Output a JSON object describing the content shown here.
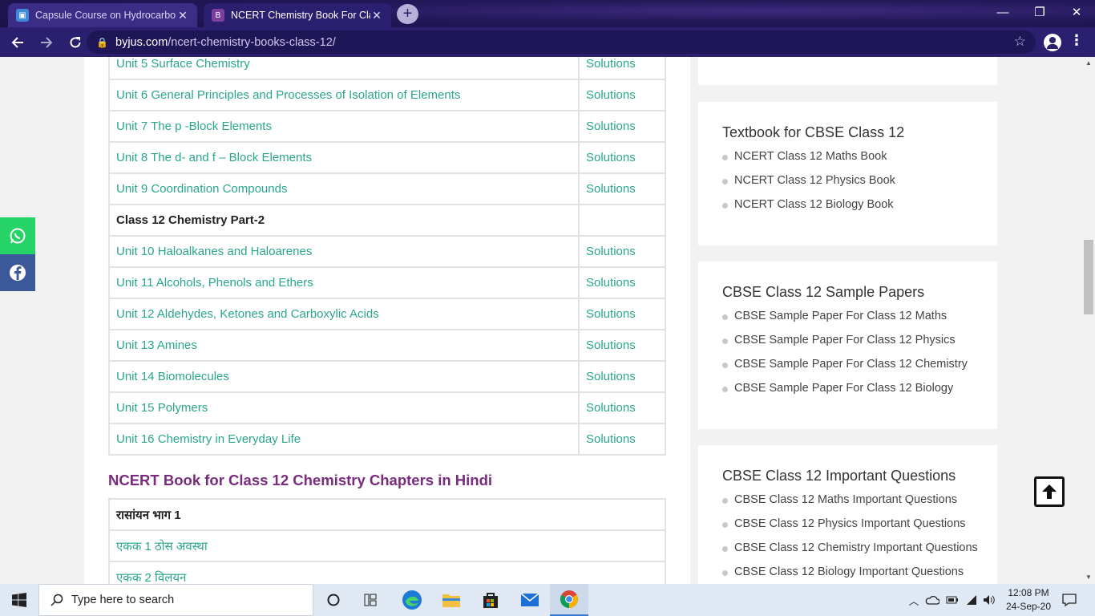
{
  "browser": {
    "tabs": [
      {
        "title": "Capsule Course on Hydrocarbon",
        "active": false
      },
      {
        "title": "NCERT Chemistry Book For Class",
        "active": true
      }
    ],
    "url_host": "byjus.com",
    "url_path": "/ncert-chemistry-books-class-12/"
  },
  "chapters_table": {
    "rows": [
      {
        "chapter": "Unit 5 Surface Chemistry",
        "solutions": "Solutions"
      },
      {
        "chapter": "Unit 6 General Principles and Processes of Isolation of Elements",
        "solutions": "Solutions"
      },
      {
        "chapter": "Unit 7 The p -Block Elements",
        "solutions": "Solutions"
      },
      {
        "chapter": "Unit 8 The d- and f – Block Elements",
        "solutions": "Solutions"
      },
      {
        "chapter": "Unit 9 Coordination Compounds",
        "solutions": "Solutions"
      },
      {
        "chapter": "Class 12 Chemistry Part-2",
        "solutions": ""
      },
      {
        "chapter": "Unit 10 Haloalkanes and Haloarenes",
        "solutions": "Solutions"
      },
      {
        "chapter": "Unit 11 Alcohols, Phenols and Ethers",
        "solutions": "Solutions"
      },
      {
        "chapter": "Unit 12 Aldehydes, Ketones and Carboxylic Acids",
        "solutions": "Solutions"
      },
      {
        "chapter": "Unit 13 Amines",
        "solutions": "Solutions"
      },
      {
        "chapter": "Unit 14 Biomolecules",
        "solutions": "Solutions"
      },
      {
        "chapter": "Unit 15 Polymers",
        "solutions": "Solutions"
      },
      {
        "chapter": "Unit 16 Chemistry in Everyday Life",
        "solutions": "Solutions"
      }
    ]
  },
  "hindi_section": {
    "title": "NCERT Book for Class 12 Chemistry Chapters in Hindi",
    "rows": [
      "रासांयन भाग 1",
      "एकक 1 ठोस अवस्था",
      "एकक 2 विलयन"
    ]
  },
  "sidebar": {
    "textbooks": {
      "title": "Textbook for CBSE Class 12",
      "items": [
        "NCERT Class 12 Maths Book",
        "NCERT Class 12 Physics Book",
        "NCERT Class 12 Biology Book"
      ]
    },
    "sample_papers": {
      "title": "CBSE Class 12 Sample Papers",
      "items": [
        "CBSE Sample Paper For Class 12 Maths",
        "CBSE Sample Paper For Class 12 Physics",
        "CBSE Sample Paper For Class 12 Chemistry",
        "CBSE Sample Paper For Class 12 Biology"
      ]
    },
    "important_questions": {
      "title": "CBSE Class 12 Important Questions",
      "items": [
        "CBSE Class 12 Maths Important Questions",
        "CBSE Class 12 Physics Important Questions",
        "CBSE Class 12 Chemistry Important Questions",
        "CBSE Class 12 Biology Important Questions"
      ]
    }
  },
  "taskbar": {
    "search_placeholder": "Type here to search",
    "time": "12:08 PM",
    "date": "24-Sep-20"
  },
  "colors": {
    "link": "#2aa68c",
    "heading_purple": "#7a2b7e",
    "browser_frame": "#2b2070",
    "whatsapp": "#25d366",
    "facebook": "#3b5998"
  }
}
